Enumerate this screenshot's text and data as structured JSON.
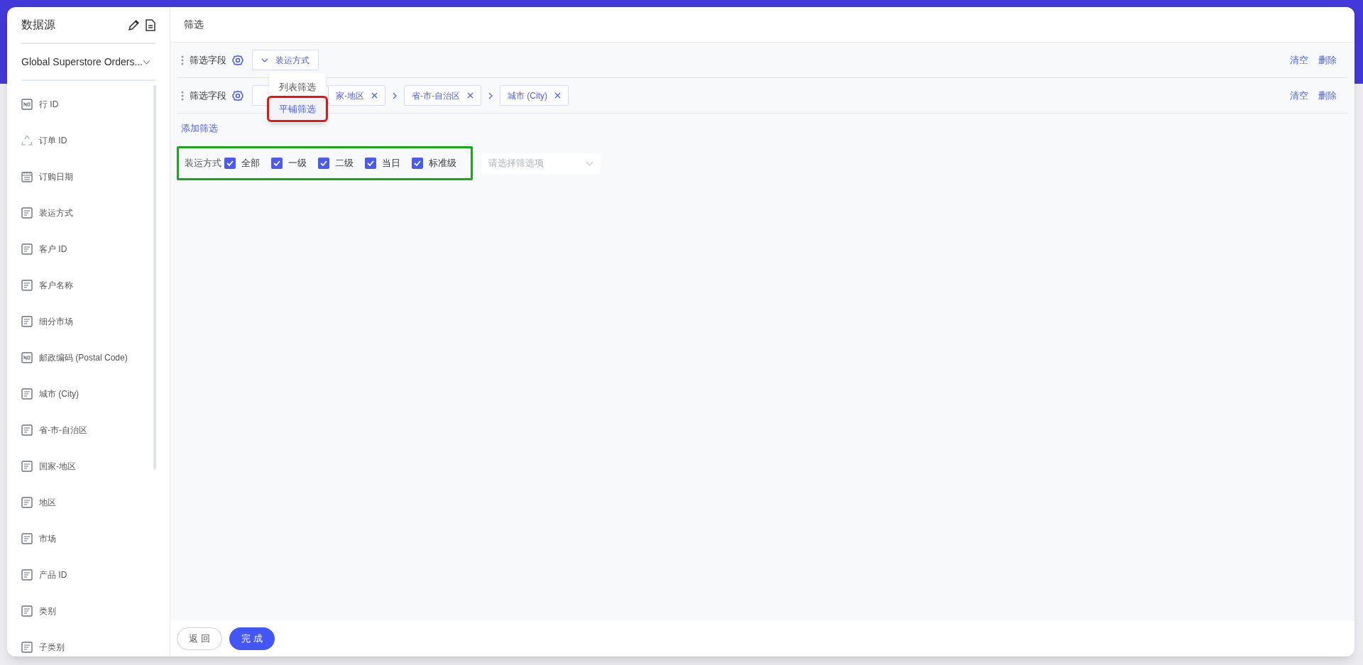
{
  "sidebar": {
    "title": "数据源",
    "datasource": "Global Superstore Orders...",
    "fields": [
      {
        "label": "行 ID",
        "kind": "number"
      },
      {
        "label": "订单 ID",
        "kind": "other"
      },
      {
        "label": "订购日期",
        "kind": "date"
      },
      {
        "label": "装运方式",
        "kind": "string"
      },
      {
        "label": "客户 ID",
        "kind": "string"
      },
      {
        "label": "客户名称",
        "kind": "string"
      },
      {
        "label": "细分市场",
        "kind": "string"
      },
      {
        "label": "邮政编码 (Postal Code)",
        "kind": "number"
      },
      {
        "label": "城市 (City)",
        "kind": "string"
      },
      {
        "label": "省-市-自治区",
        "kind": "string"
      },
      {
        "label": "国家-地区",
        "kind": "string"
      },
      {
        "label": "地区",
        "kind": "string"
      },
      {
        "label": "市场",
        "kind": "string"
      },
      {
        "label": "产品 ID",
        "kind": "string"
      },
      {
        "label": "类别",
        "kind": "string"
      },
      {
        "label": "子类别",
        "kind": "string"
      }
    ]
  },
  "header": {
    "title": "筛选"
  },
  "filters": [
    {
      "label": "筛选字段",
      "value": "装运方式",
      "clear": "清空",
      "delete": "删除"
    },
    {
      "label": "筛选字段",
      "tags": [
        "家-地区",
        "省-市-自治区",
        "城市 (City)"
      ],
      "clear": "清空",
      "delete": "删除"
    }
  ],
  "menu": {
    "items": [
      {
        "label": "列表筛选",
        "selected": false
      },
      {
        "label": "平铺筛选",
        "selected": true
      }
    ]
  },
  "add_filter": "添加筛选",
  "tile_filter": {
    "label": "装运方式",
    "options": [
      {
        "label": "全部",
        "checked": true
      },
      {
        "label": "一级",
        "checked": true
      },
      {
        "label": "二级",
        "checked": true
      },
      {
        "label": "当日",
        "checked": true
      },
      {
        "label": "标准级",
        "checked": true
      }
    ],
    "placeholder": "请选择筛选项"
  },
  "footer": {
    "buttons": [
      {
        "label": "返 回",
        "kind": "secondary"
      },
      {
        "label": "完 成",
        "kind": "primary"
      }
    ]
  }
}
